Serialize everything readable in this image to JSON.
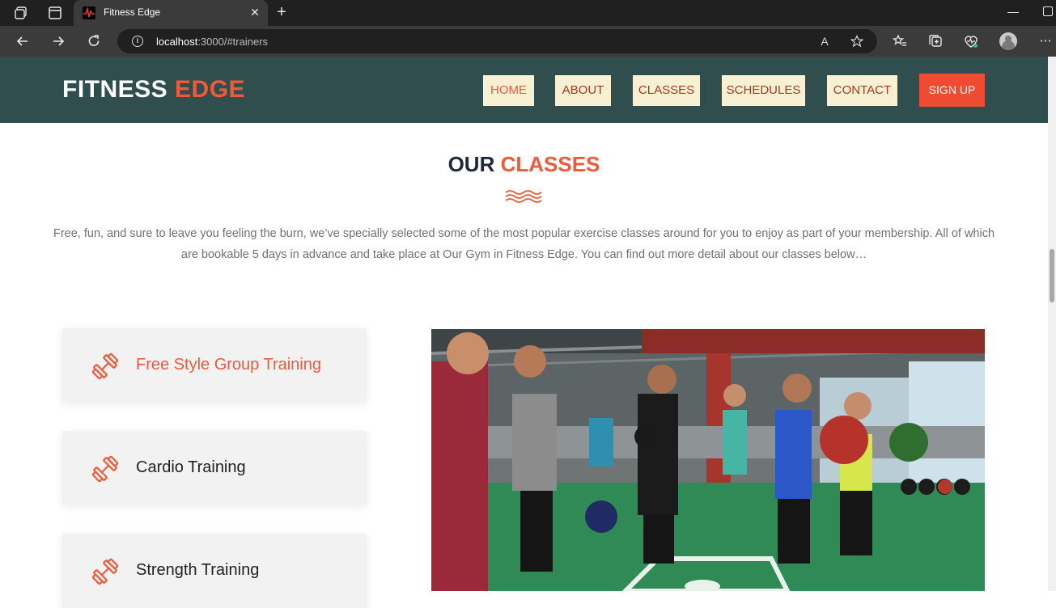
{
  "browser": {
    "tab_title": "Fitness Edge",
    "url_host": "localhost",
    "url_rest": ":3000/#trainers",
    "tab_close_label": "✕",
    "new_tab_label": "+"
  },
  "site": {
    "logo_main": "FITNESS",
    "logo_accent": "EDGE",
    "nav": [
      "HOME",
      "ABOUT",
      "CLASSES",
      "SCHEDULES",
      "CONTACT"
    ],
    "signup_label": "SIGN UP"
  },
  "section": {
    "title_main": "OUR",
    "title_accent": "CLASSES",
    "description": "Free, fun, and sure to leave you feeling the burn, we’ve specially selected some of the most popular exercise classes around for you to enjoy as part of your membership. All of which are bookable 5 days in advance and take place at Our Gym in Fitness Edge. You can find out more detail about our classes below…"
  },
  "classes": [
    {
      "label": "Free Style Group Training",
      "active": true
    },
    {
      "label": "Cardio Training",
      "active": false
    },
    {
      "label": "Strength Training",
      "active": false
    }
  ],
  "colors": {
    "header_bg": "#2f4e4d",
    "accent": "#ee5a3a",
    "nav_bg": "#f7f0d2",
    "nav_text": "#a33a1a",
    "signup_bg": "#ee4b33"
  }
}
